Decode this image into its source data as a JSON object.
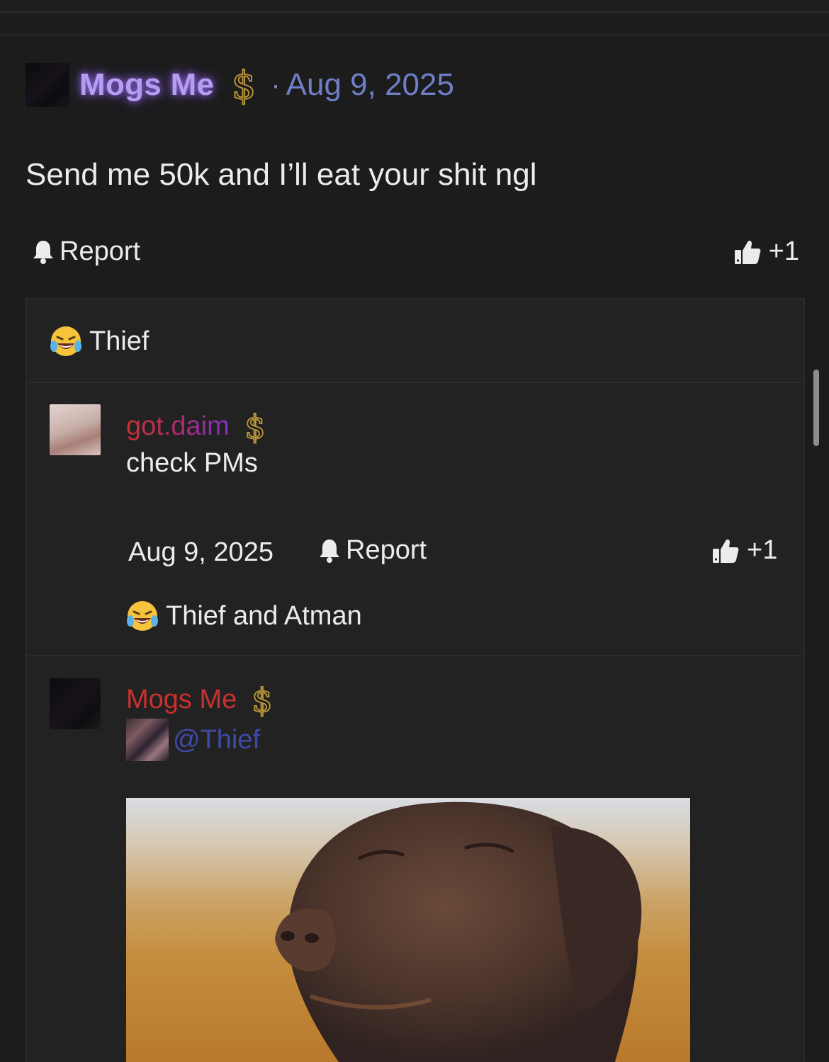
{
  "post": {
    "author": "Mogs Me",
    "separator": "·",
    "date": "Aug 9, 2025",
    "body": "Send me 50k and I’ll eat your shit ngl",
    "report_label": "Report",
    "like_count": "+1"
  },
  "thread": {
    "reactors": "Thief",
    "replies": [
      {
        "author": "got.daim",
        "text": "check PMs",
        "date": "Aug 9, 2025",
        "report_label": "Report",
        "like_count": "+1",
        "reactors": "Thief and Atman"
      },
      {
        "author": "Mogs Me",
        "mention": "@Thief"
      }
    ]
  },
  "icons": {
    "supporter_badge": "dollar-icon",
    "report": "bell-icon",
    "like": "thumbs-up-icon",
    "reaction": "laughing-crying-emoji"
  },
  "colors": {
    "background": "#1c1c1c",
    "author_glow": "#b49ef0",
    "date_blue": "#6f7ec7",
    "gold": "#b8943a",
    "mention_blue": "#3e4aa8",
    "name_red": "#c8312f"
  }
}
